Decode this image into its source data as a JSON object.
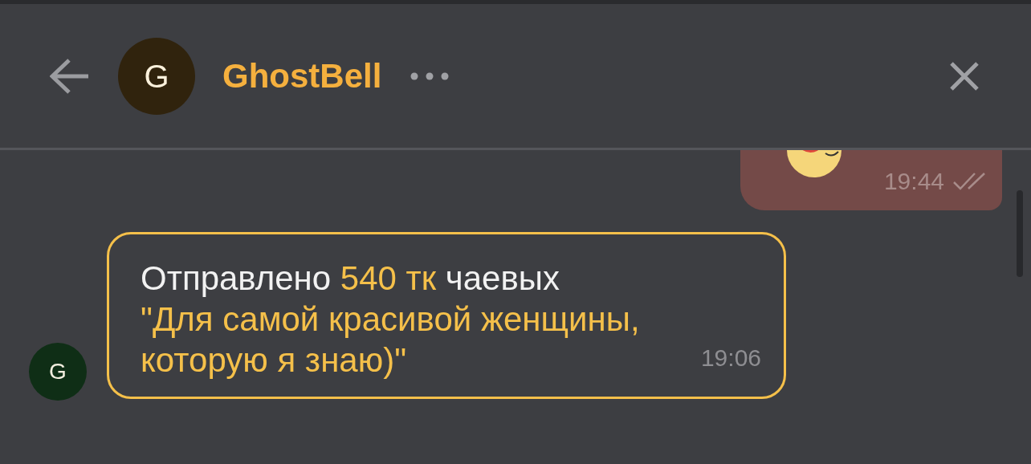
{
  "header": {
    "avatar_letter": "G",
    "name": "GhostBell"
  },
  "messages": [
    {
      "kind": "outgoing",
      "time": "19:44",
      "read": true
    },
    {
      "kind": "incoming",
      "avatar_letter": "G",
      "parts": [
        {
          "text": "Отправлено ",
          "highlight": false
        },
        {
          "text": "540 тк",
          "highlight": true
        },
        {
          "text": " чаевых",
          "highlight": false
        }
      ],
      "quote": "\"Для самой красивой женщины, которую я знаю)\"",
      "time": "19:06"
    }
  ]
}
